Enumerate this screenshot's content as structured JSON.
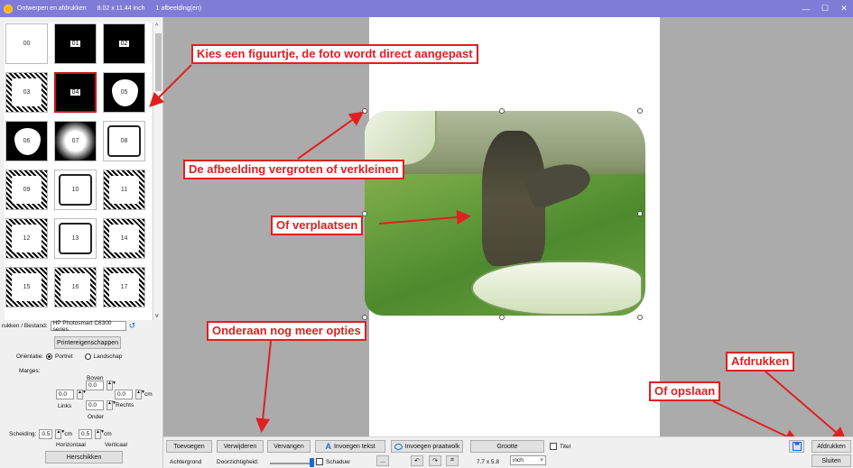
{
  "title": {
    "app_name": "Ontwerpen en afdrukken",
    "size": "8.02 x 11.44 inch",
    "count": "1 afbeelding(en)",
    "icons": [
      "app-icon",
      "minimize-icon",
      "maximize-icon",
      "close-icon"
    ]
  },
  "window_controls": {
    "minimize": "—",
    "maximize": "☐",
    "close": "✕"
  },
  "thumbnails": [
    "00",
    "01",
    "02",
    "03",
    "04",
    "05",
    "06",
    "07",
    "08",
    "09",
    "10",
    "11",
    "12",
    "13",
    "14",
    "15",
    "16",
    "17"
  ],
  "selected_thumbnail": "04",
  "left": {
    "printer_label": "rukken / Bestand:",
    "printer_value": "HP Photosmart C6300 series",
    "refresh_icon": "↺",
    "printer_properties": "Printereigenschappen",
    "orientation_label": "Oriëntatie:",
    "portrait": "Portret",
    "landscape": "Landschap",
    "margins_label": "Marges:",
    "top_label": "Boven",
    "top_value": "0.0",
    "left_value": "0.0",
    "right_value": "0.0",
    "left_label": "Links",
    "right_label": "Rechts",
    "bottom_value": "0.0",
    "bottom_label": "Onder",
    "unit_cm": "cm",
    "spacing_label": "Scheiding:",
    "spacing_h": "0.5",
    "spacing_v": "0.5",
    "horizontal_label": "Horizontaal",
    "vertical_label": "Verticaal",
    "rearrange": "Herschikken"
  },
  "toolbar": {
    "add": "Toevoegen",
    "remove": "Verwijderen",
    "replace": "Vervangen",
    "insert_text": "Invoegen tekst",
    "insert_text_icon": "A",
    "insert_bubble": "Invoegen praatwolk",
    "size": "Grootte",
    "title_label": "Titel",
    "print": "Afdrukken",
    "background": "Achtergrond",
    "transparency": "Doorzichtigheid:",
    "shadow": "Schaduw",
    "more": "...",
    "dimensions": "7.7 x 5.8",
    "unit": "inch",
    "close": "Sluiten"
  },
  "annotations": {
    "choose_figure": "Kies een figuurtje, de foto wordt direct aangepast",
    "resize": "De afbeelding vergroten of verkleinen",
    "move": "Of verplaatsen",
    "more_options": "Onderaan nog meer opties",
    "print": "Afdrukken",
    "save": "Of opslaan"
  },
  "colors": {
    "titlebar": "#7e7cd6",
    "annotation": "#e02020",
    "gray": "#ababab"
  }
}
